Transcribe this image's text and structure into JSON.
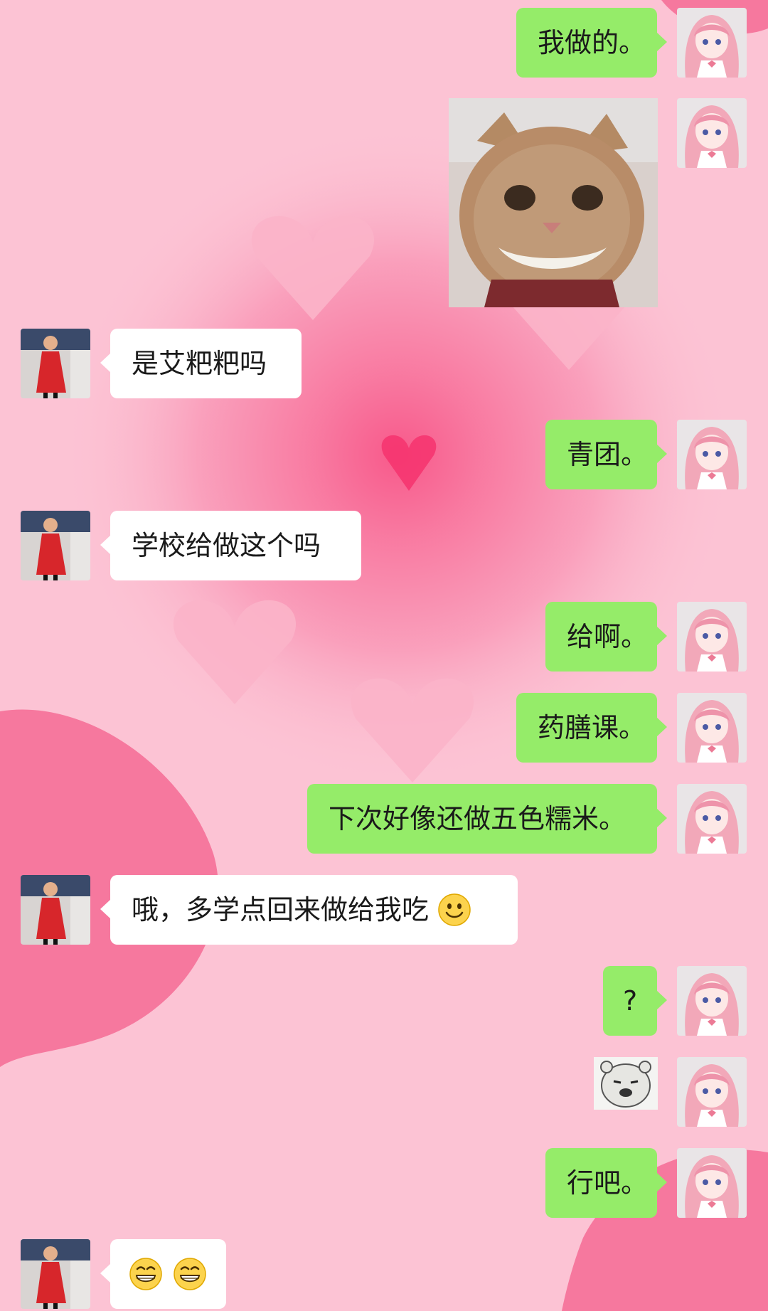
{
  "chat": {
    "messages": [
      {
        "from": "me",
        "type": "text",
        "text": "我做的。"
      },
      {
        "from": "me",
        "type": "image",
        "image": "smiling-cat-photo"
      },
      {
        "from": "other",
        "type": "text",
        "text": "是艾粑粑吗"
      },
      {
        "from": "me",
        "type": "text",
        "text": "青团。"
      },
      {
        "from": "other",
        "type": "text",
        "text": "学校给做这个吗"
      },
      {
        "from": "me",
        "type": "text",
        "text": "给啊。"
      },
      {
        "from": "me",
        "type": "text",
        "text": "药膳课。"
      },
      {
        "from": "me",
        "type": "text",
        "text": "下次好像还做五色糯米。"
      },
      {
        "from": "other",
        "type": "text",
        "text": "哦，多学点回来做给我吃",
        "emoji": "smile-emoji"
      },
      {
        "from": "me",
        "type": "text",
        "text": "?"
      },
      {
        "from": "me",
        "type": "sticker",
        "image": "bear-meme-sticker"
      },
      {
        "from": "me",
        "type": "text",
        "text": "行吧。"
      },
      {
        "from": "other",
        "type": "emoji",
        "emoji": [
          "grin-emoji",
          "grin-emoji"
        ]
      }
    ]
  },
  "colors": {
    "background": "#fbc0d2",
    "my_bubble": "#95ec69",
    "their_bubble": "#ffffff"
  }
}
